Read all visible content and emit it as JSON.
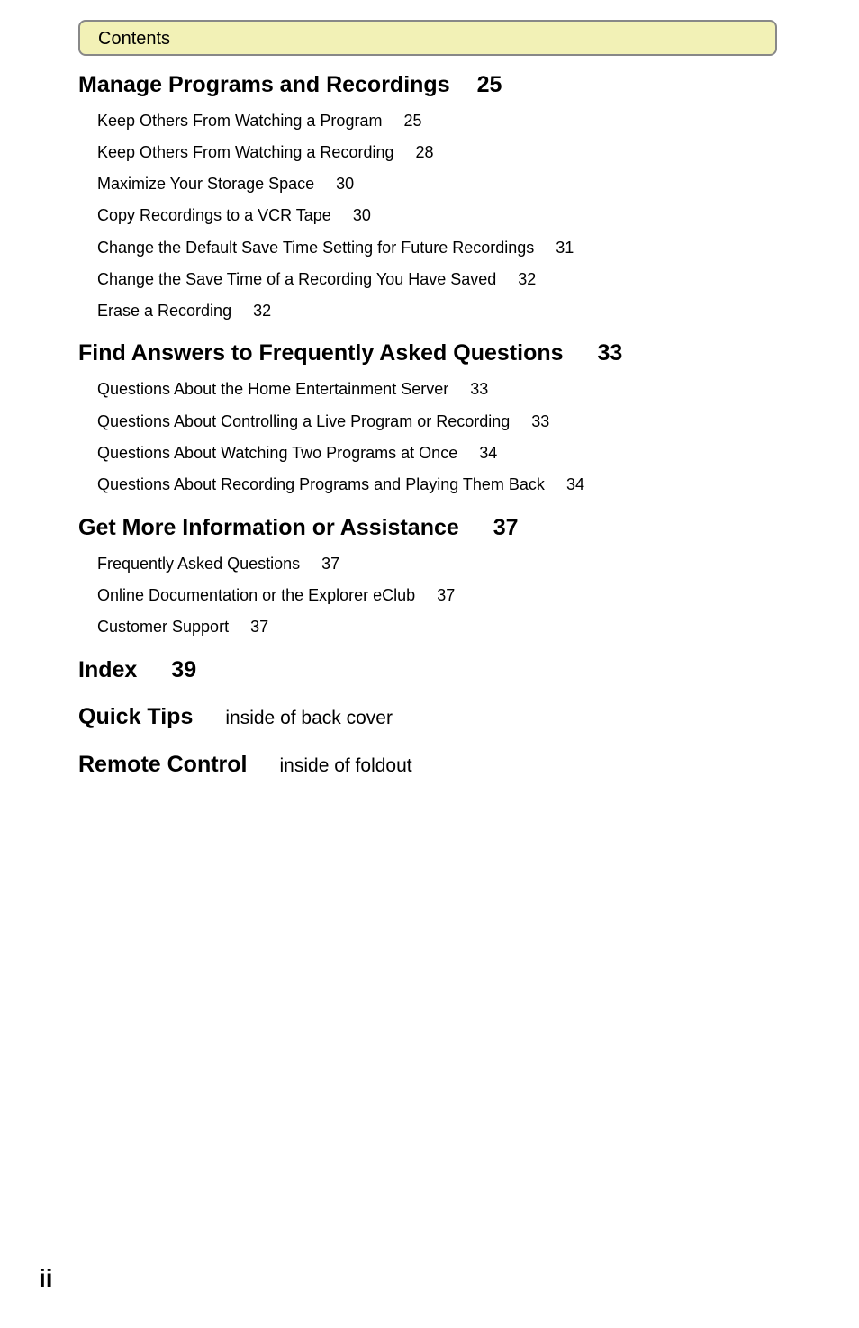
{
  "header": {
    "title": "Contents"
  },
  "sections": [
    {
      "title": "Manage Programs and Recordings",
      "page": "25",
      "items": [
        {
          "label": "Keep Others From Watching a Program",
          "page": "25"
        },
        {
          "label": "Keep Others From Watching a Recording",
          "page": "28"
        },
        {
          "label": "Maximize Your Storage Space",
          "page": "30"
        },
        {
          "label": "Copy Recordings to a VCR Tape",
          "page": "30"
        },
        {
          "label": "Change the Default Save Time Setting for Future Recordings",
          "page": "31"
        },
        {
          "label": "Change the Save Time of a Recording You Have Saved",
          "page": "32"
        },
        {
          "label": "Erase a Recording",
          "page": "32"
        }
      ]
    },
    {
      "title": "Find Answers to Frequently Asked Questions",
      "page": "33",
      "items": [
        {
          "label": "Questions About the Home Entertainment Server",
          "page": "33"
        },
        {
          "label": "Questions About Controlling a Live Program or Recording",
          "page": "33"
        },
        {
          "label": "Questions About Watching Two Programs at Once",
          "page": "34"
        },
        {
          "label": "Questions About Recording Programs and Playing Them Back",
          "page": "34"
        }
      ]
    },
    {
      "title": "Get More Information or Assistance",
      "page": "37",
      "items": [
        {
          "label": "Frequently Asked Questions",
          "page": "37"
        },
        {
          "label": "Online Documentation or the Explorer eClub",
          "page": "37"
        },
        {
          "label": "Customer Support",
          "page": "37"
        }
      ]
    }
  ],
  "index": {
    "title": "Index",
    "page": "39"
  },
  "quick_tips": {
    "title": "Quick Tips",
    "location": "inside of back cover"
  },
  "remote_control": {
    "title": "Remote Control",
    "location": "inside of foldout"
  },
  "footer": {
    "page_number": "ii"
  }
}
